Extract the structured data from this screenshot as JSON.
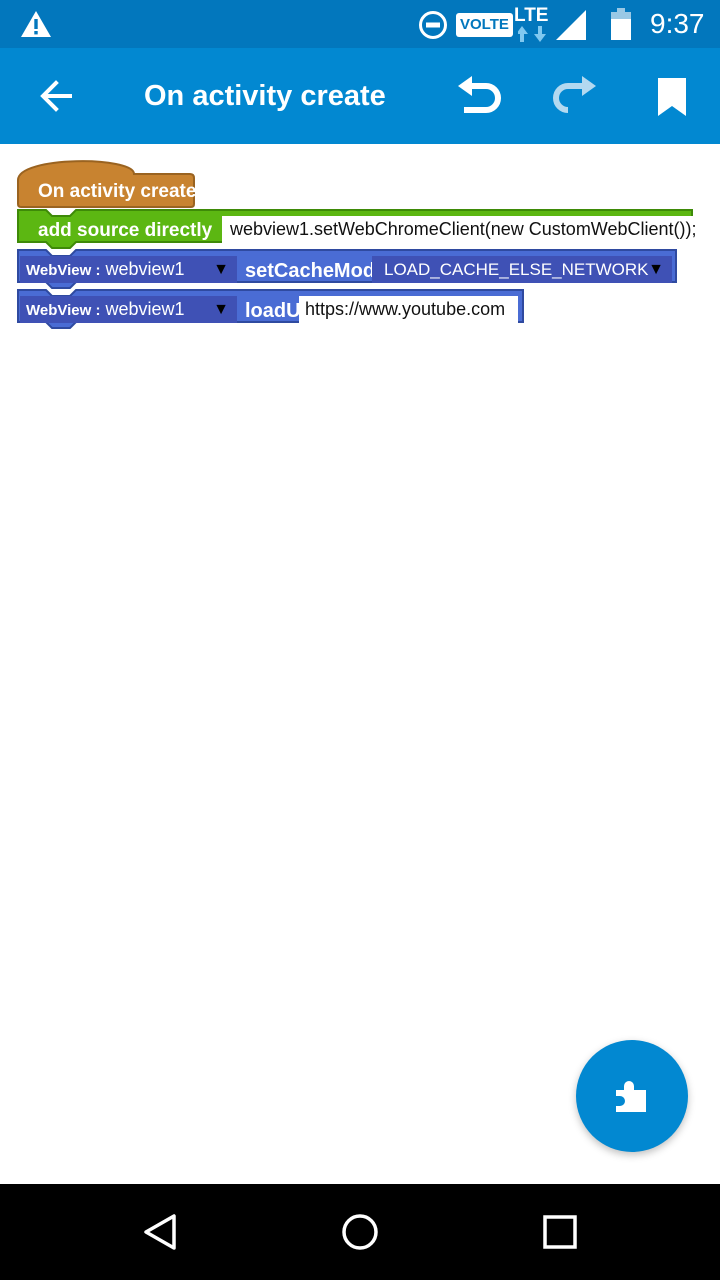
{
  "status_bar": {
    "volte": "VOLTE",
    "network": "LTE",
    "time": "9:37",
    "icons": [
      "warning-icon",
      "do-not-disturb-icon",
      "signal-icon",
      "battery-icon"
    ]
  },
  "app_bar": {
    "title": "On activity create",
    "icons": [
      "back-arrow-icon",
      "undo-icon",
      "redo-icon",
      "bookmark-icon"
    ]
  },
  "blocks": {
    "event": {
      "label": "On activity create"
    },
    "add_source": {
      "label": "add source directly",
      "code": "webview1.setWebChromeClient(new CustomWebClient());"
    },
    "set_cache": {
      "component_type": "WebView :",
      "component": "webview1",
      "method": "setCacheMode",
      "mode": "LOAD_CACHE_ELSE_NETWORK"
    },
    "load_url": {
      "component_type": "WebView :",
      "component": "webview1",
      "method": "loadUrl",
      "url": "https://www.youtube.com"
    }
  },
  "colors": {
    "status_bar": "#0277bd",
    "app_bar": "#0288d1",
    "event_block": "#c88330",
    "source_block": "#5cb712",
    "component_block": "#4a6cd4",
    "fab": "#0288d1"
  },
  "fab": {
    "icon": "puzzle-piece-icon"
  },
  "nav_bar": {
    "icons": [
      "nav-back-icon",
      "nav-home-icon",
      "nav-recents-icon"
    ]
  }
}
